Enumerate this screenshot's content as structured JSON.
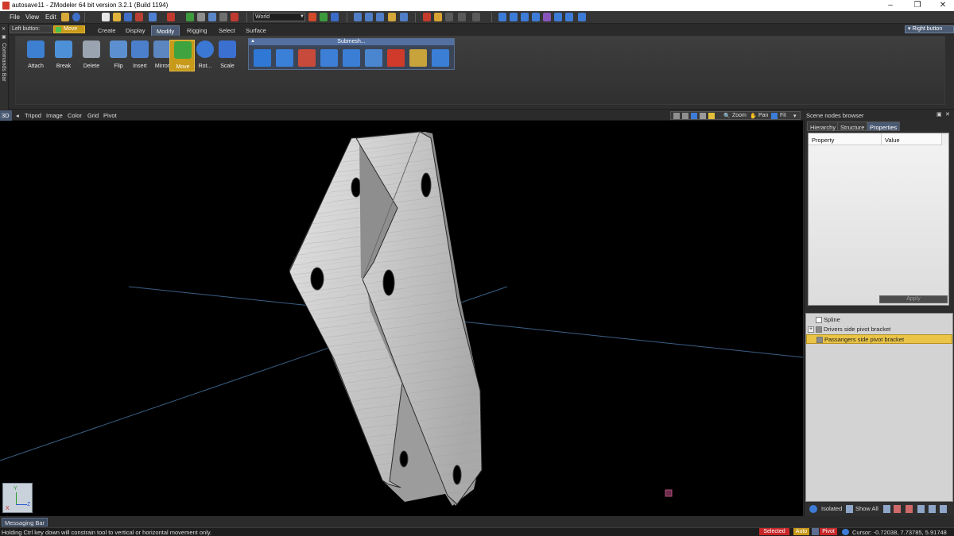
{
  "window": {
    "title": "autosave11 - ZModeler 64 bit version 3.2.1 (Build 1194)",
    "controls": [
      "–",
      "❐",
      "✕"
    ]
  },
  "menu": [
    "File",
    "View",
    "Edit"
  ],
  "toolbar": {
    "coordinate_space": "World"
  },
  "left_button": {
    "label": "Left button:",
    "mode": "Move"
  },
  "right_button": {
    "label": "Right button"
  },
  "tabs": [
    "Create",
    "Display",
    "Modify",
    "Rigging",
    "Select",
    "Surface"
  ],
  "active_tab": "Modify",
  "commands_bar": {
    "label": "Commands Bar"
  },
  "ribbon": {
    "buttons": [
      {
        "label": "Attach",
        "icon": "attach-icon",
        "color": "#3d7fd1"
      },
      {
        "label": "Break",
        "icon": "break-icon",
        "color": "#4e90d8"
      },
      {
        "label": "Delete",
        "icon": "delete-icon",
        "color": "#9aa4b0"
      },
      {
        "label": "Flip",
        "icon": "flip-icon",
        "color": "#5c8fcf"
      },
      {
        "label": "Insert",
        "icon": "insert-icon",
        "color": "#4b7fcb"
      },
      {
        "label": "Mirror",
        "icon": "mirror-icon",
        "color": "#5b86c0"
      },
      {
        "label": "Move",
        "icon": "move-icon",
        "color": "#3fa43f"
      },
      {
        "label": "Rot...",
        "icon": "rotate-icon",
        "color": "#3b78d4"
      },
      {
        "label": "Scale",
        "icon": "scale-icon",
        "color": "#3b6fd0"
      }
    ],
    "active_button": "Move",
    "submesh": {
      "title": "Submesh...",
      "icons": [
        "submesh-box-icon",
        "submesh-paint-icon",
        "submesh-split-icon",
        "submesh-detach-icon",
        "submesh-flip-icon",
        "submesh-grid-icon",
        "submesh-red-icon",
        "submesh-gold-icon",
        "submesh-blue-icon"
      ],
      "colors": [
        "#2f78d6",
        "#3a7fd8",
        "#c84a3a",
        "#3d7fd6",
        "#3b7ed6",
        "#4a86d0",
        "#d03a2a",
        "#c8a23a",
        "#3b7ed6"
      ]
    }
  },
  "viewport": {
    "mode": "3D",
    "menu": [
      "Tripod",
      "Image",
      "Color",
      "Grid",
      "Pivot"
    ],
    "tools": [
      "Zoom",
      "Pan",
      "Fit"
    ],
    "axis_labels": [
      "Y",
      "X",
      "Z"
    ]
  },
  "scene_browser": {
    "title": "Scene nodes browser",
    "tabs": [
      "Hierarchy",
      "Structure",
      "Properties"
    ],
    "active_tab": "Properties",
    "columns": [
      "Property",
      "Value"
    ],
    "apply_label": "Apply",
    "nodes": [
      {
        "name": "Spline",
        "selected": false,
        "expandable": false
      },
      {
        "name": "Drivers side pivot bracket",
        "selected": false,
        "expandable": true
      },
      {
        "name": "Passangers side pivot bracket",
        "selected": true,
        "expandable": false
      }
    ],
    "bottom_bar": [
      "Isolated",
      "Show All"
    ]
  },
  "messaging_bar": {
    "label": "Messaging Bar"
  },
  "status": {
    "hint": "Holding Ctrl key down will constrain tool to vertical or horizontal movement only.",
    "selected_label": "Selected",
    "auto_label": "Auto",
    "pivot_label": "Pivot",
    "cursor_label": "Cursor: -0.72038, 7.73785, 5.91748"
  }
}
